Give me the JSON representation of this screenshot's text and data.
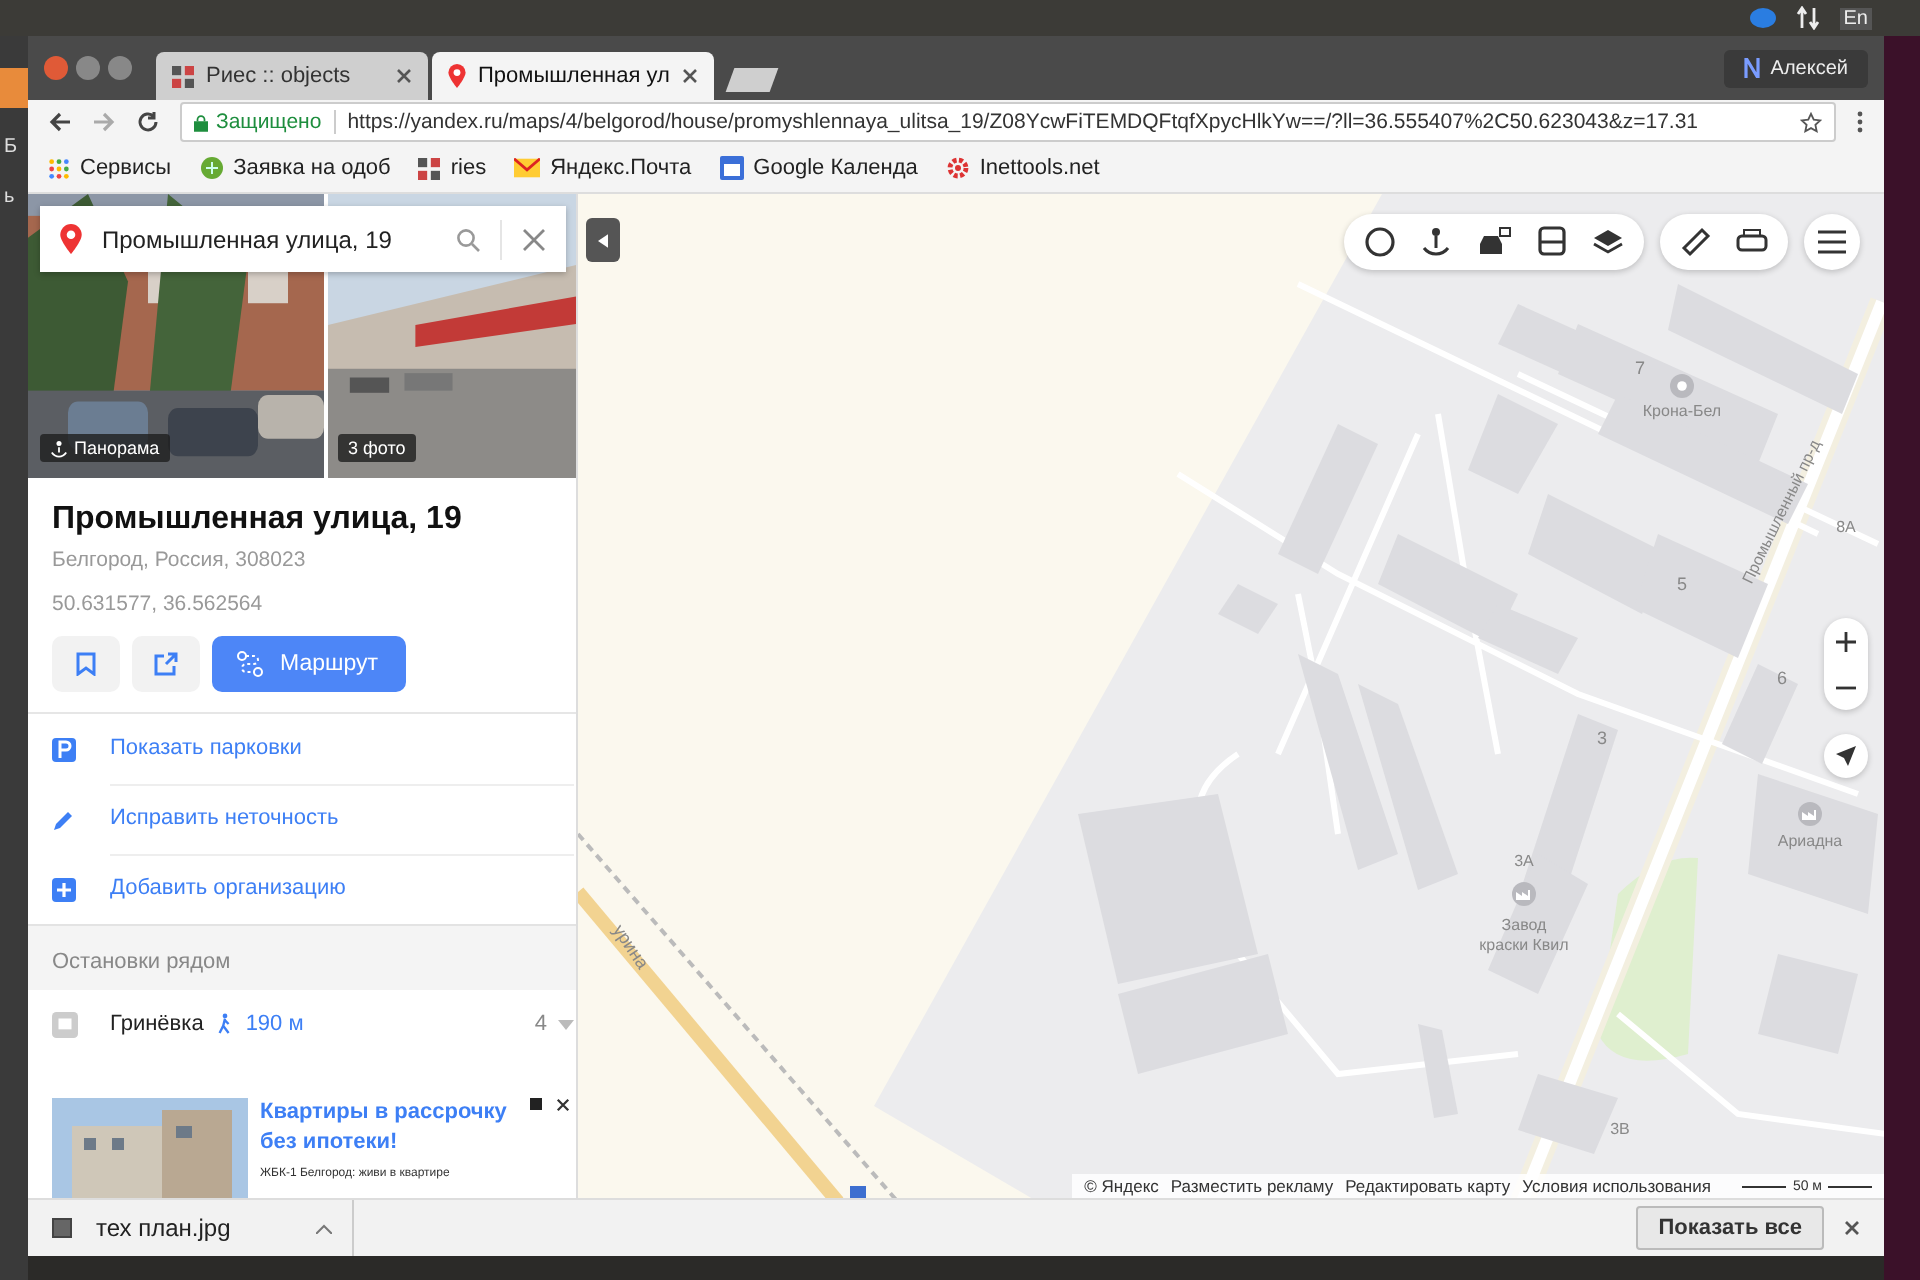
{
  "desktop": {
    "language": "En",
    "side_texts": [
      "Б",
      "ь"
    ]
  },
  "browser": {
    "tabs": [
      {
        "title": "Риес :: objects",
        "selected": false
      },
      {
        "title": "Промышленная ул",
        "selected": true
      }
    ],
    "user": "Алексей",
    "secure_label": "Защищено",
    "url": "https://yandex.ru/maps/4/belgorod/house/promyshlennaya_ulitsa_19/Z08YcwFiTEMDQFtqfXpycHlkYw==/?ll=36.555407%2C50.623043&z=17.31",
    "bookmarks": [
      {
        "label": "Сервисы",
        "kind": "apps"
      },
      {
        "label": "Заявка на одоб",
        "kind": "leaf"
      },
      {
        "label": "ries",
        "kind": "page"
      },
      {
        "label": "Яндекс.Почта",
        "kind": "mail"
      },
      {
        "label": "Google Календа",
        "kind": "calendar"
      },
      {
        "label": "Inettools.net",
        "kind": "gear"
      }
    ]
  },
  "panel": {
    "search": {
      "value": "Промышленная улица, 19"
    },
    "photo_badges": [
      "Панорама",
      "3 фото"
    ],
    "title": "Промышленная улица, 19",
    "address": "Белгород, Россия, 308023",
    "coordinates": "50.631577, 36.562564",
    "route_button": "Маршрут",
    "actions": [
      {
        "label": "Показать парковки",
        "kind": "parking"
      },
      {
        "label": "Исправить неточность",
        "kind": "edit"
      },
      {
        "label": "Добавить организацию",
        "kind": "add"
      }
    ],
    "stops_heading": "Остановки рядом",
    "stop": {
      "name": "Гринёвка",
      "distance": "190 м",
      "count": "4"
    },
    "ad": {
      "title": "Квартиры в рассрочку без ипотеки!",
      "text": "ЖБК-1 Белгород: живи в квартире"
    }
  },
  "map": {
    "labels": [
      "7",
      "Крона-Бел",
      "Промышленный пр-д",
      "8А",
      "5",
      "6",
      "3",
      "3А",
      "Завод",
      "краски Квил",
      "Ариадна",
      "3В",
      "урина"
    ],
    "footer": [
      "© Яндекс",
      "Разместить рекламу",
      "Редактировать карту",
      "Условия использования"
    ],
    "scale": "50 м"
  },
  "downloads": {
    "file": "тех план.jpg",
    "show_all": "Показать все"
  }
}
